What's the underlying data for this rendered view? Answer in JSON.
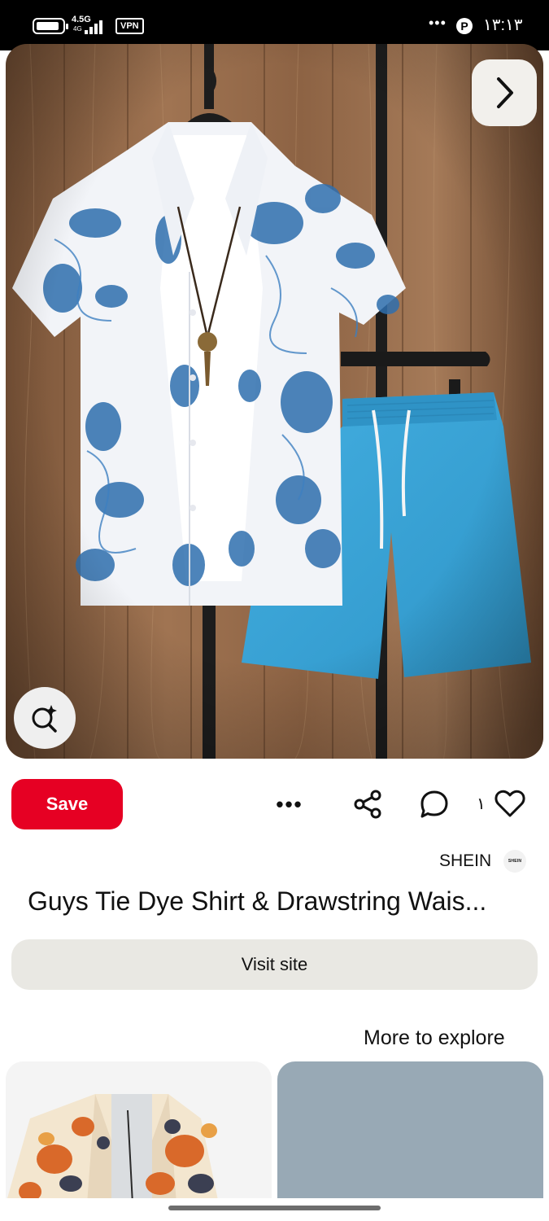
{
  "status_bar": {
    "network_type": "4.5G",
    "network_sub": "4G",
    "vpn_label": "VPN",
    "overflow_dots": "•••",
    "app_badge": "P",
    "time": "۱۳:۱۳"
  },
  "pin": {
    "image_description_icon": "outfit-photo",
    "next_icon": "chevron-right-icon",
    "visual_search_icon": "lens-sparkle-icon"
  },
  "actions": {
    "save_label": "Save",
    "more_label": "•••",
    "share_icon": "share-icon",
    "comment_icon": "comment-icon",
    "reaction_count": "۱",
    "heart_icon": "heart-icon"
  },
  "source": {
    "name": "SHEIN",
    "logo_text": "SHEIN"
  },
  "title": "Guys Tie Dye Shirt & Drawstring Wais...",
  "visit_label": "Visit site",
  "more_to_explore": "More to explore",
  "colors": {
    "save_red": "#e60023",
    "visit_gray": "#e9e8e3",
    "shorts_blue": "#3ea6d9",
    "tie_dye_blue": "#2f6fae"
  }
}
